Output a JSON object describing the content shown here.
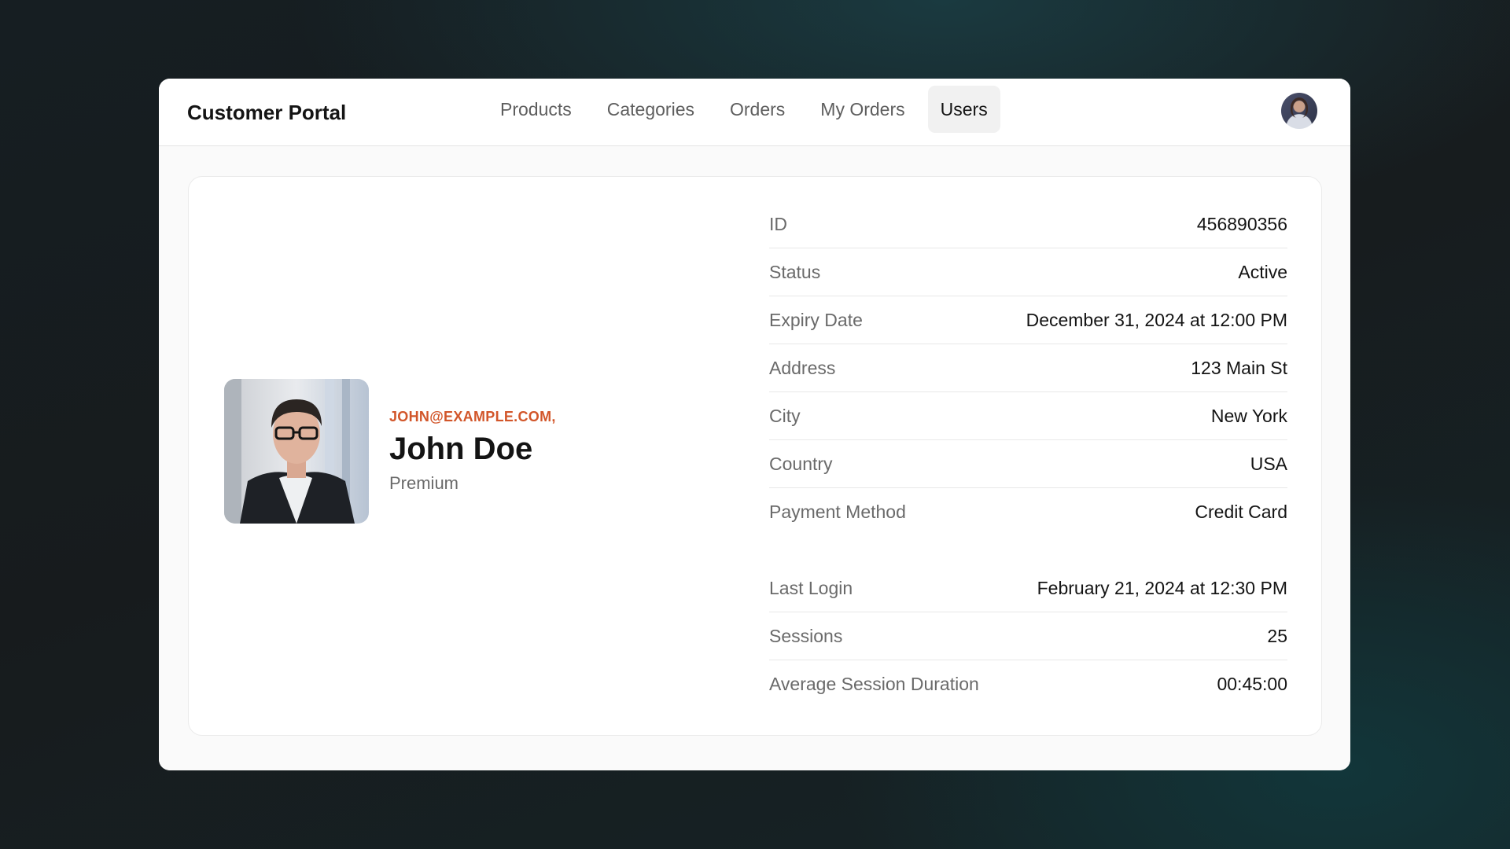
{
  "app": {
    "title": "Customer Portal"
  },
  "nav": {
    "items": [
      {
        "label": "Products",
        "active": false
      },
      {
        "label": "Categories",
        "active": false
      },
      {
        "label": "Orders",
        "active": false
      },
      {
        "label": "My Orders",
        "active": false
      },
      {
        "label": "Users",
        "active": true
      }
    ]
  },
  "profile": {
    "email": "JOHN@EXAMPLE.COM,",
    "name": "John Doe",
    "plan": "Premium"
  },
  "details": {
    "account": [
      {
        "label": "ID",
        "value": "456890356"
      },
      {
        "label": "Status",
        "value": "Active"
      },
      {
        "label": "Expiry Date",
        "value": "December 31, 2024 at 12:00 PM"
      },
      {
        "label": "Address",
        "value": "123 Main St"
      },
      {
        "label": "City",
        "value": "New York"
      },
      {
        "label": "Country",
        "value": "USA"
      },
      {
        "label": "Payment Method",
        "value": "Credit Card"
      }
    ],
    "activity": [
      {
        "label": "Last Login",
        "value": "February 21, 2024 at 12:30 PM"
      },
      {
        "label": "Sessions",
        "value": "25"
      },
      {
        "label": "Average Session Duration",
        "value": "00:45:00"
      }
    ]
  },
  "colors": {
    "accent": "#d2562a",
    "text": "#141414",
    "muted": "#6a6a6a",
    "active_tab_bg": "#f1f1f1"
  }
}
